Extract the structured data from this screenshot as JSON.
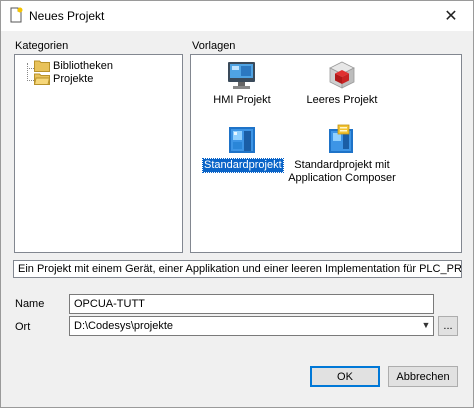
{
  "window": {
    "title": "Neues Projekt",
    "close_symbol": "✕"
  },
  "categories": {
    "label": "Kategorien",
    "items": [
      {
        "label": "Bibliotheken",
        "icon": "folder-icon"
      },
      {
        "label": "Projekte",
        "icon": "folder-open-icon"
      }
    ]
  },
  "templates": {
    "label": "Vorlagen",
    "items": [
      {
        "label": "HMI Projekt",
        "icon": "hmi-project-icon"
      },
      {
        "label": "Leeres Projekt",
        "icon": "empty-project-icon"
      },
      {
        "label": "Standardprojekt",
        "icon": "standard-project-icon",
        "selected": true
      },
      {
        "label_line1": "Standardprojekt mit",
        "label_line2": "Application Composer",
        "icon": "application-composer-icon"
      }
    ]
  },
  "description": "Ein Projekt mit einem Gerät, einer Applikation und einer leeren Implementation für PLC_PRG",
  "form": {
    "name_label": "Name",
    "name_value": "OPCUA-TUTT",
    "location_label": "Ort",
    "location_value": "D:\\Codesys\\projekte",
    "browse_label": "..."
  },
  "buttons": {
    "ok_label": "OK",
    "cancel_label": "Abbrechen"
  },
  "colors": {
    "selection": "#0a64c8",
    "folder": "#e8c25a"
  }
}
